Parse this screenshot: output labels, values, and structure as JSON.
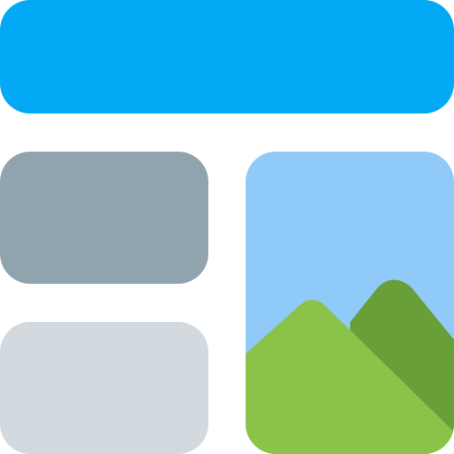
{
  "icon": {
    "name": "layout-template-icon",
    "colors": {
      "header": "#03A9F4",
      "card_top": "#90A4AE",
      "card_bottom": "#D3DADF",
      "sky": "#90CAF9",
      "mountain_back": "#689F38",
      "mountain_front": "#8BC34A"
    }
  }
}
